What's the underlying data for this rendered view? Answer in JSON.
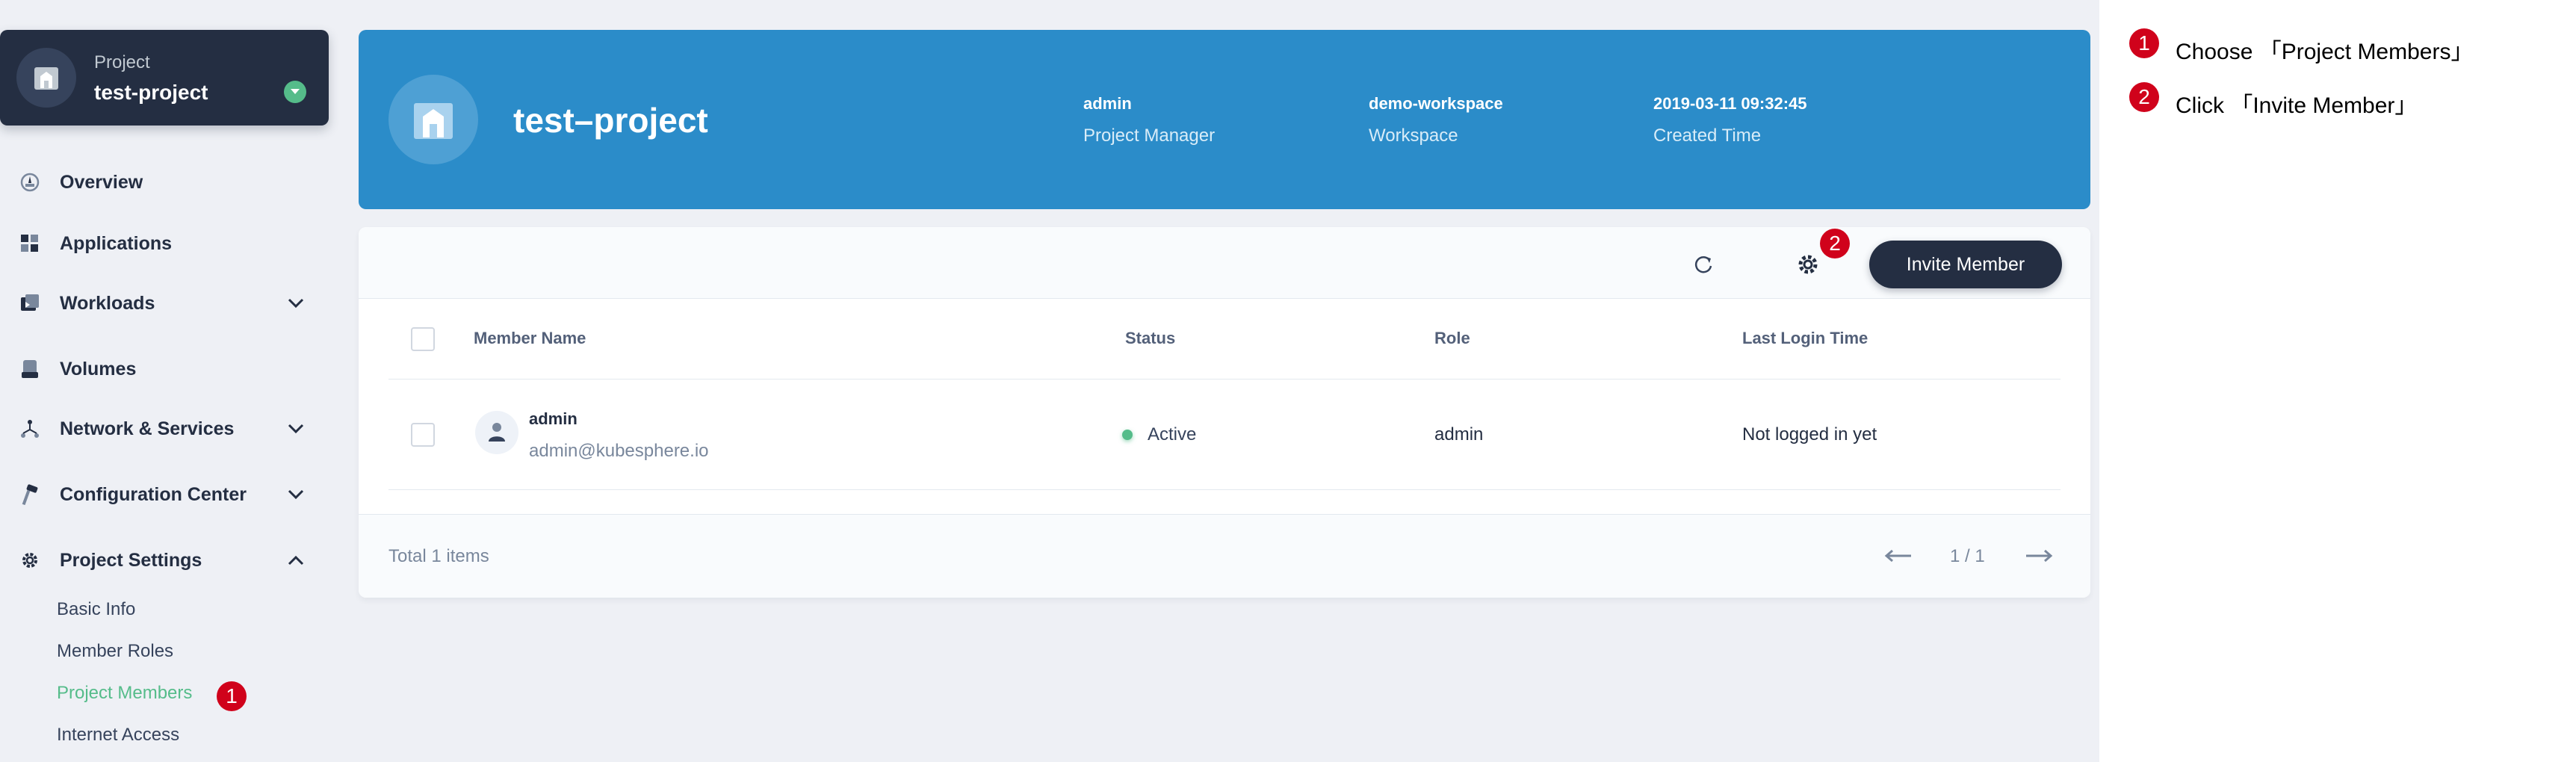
{
  "sidebar": {
    "project": {
      "label": "Project",
      "name": "test-project"
    },
    "items": [
      {
        "label": "Overview"
      },
      {
        "label": "Applications"
      },
      {
        "label": "Workloads"
      },
      {
        "label": "Volumes"
      },
      {
        "label": "Network & Services"
      },
      {
        "label": "Configuration Center"
      },
      {
        "label": "Project Settings"
      }
    ],
    "settings_sub": [
      {
        "label": "Basic Info"
      },
      {
        "label": "Member Roles"
      },
      {
        "label": "Project Members"
      },
      {
        "label": "Internet Access"
      }
    ]
  },
  "banner": {
    "title": "test–project",
    "meta": [
      {
        "value": "admin",
        "label": "Project Manager"
      },
      {
        "value": "demo-workspace",
        "label": "Workspace"
      },
      {
        "value": "2019-03-11 09:32:45",
        "label": "Created Time"
      }
    ]
  },
  "toolbar": {
    "invite_label": "Invite Member"
  },
  "table": {
    "columns": [
      "Member Name",
      "Status",
      "Role",
      "Last Login Time"
    ],
    "rows": [
      {
        "name": "admin",
        "email": "admin@kubesphere.io",
        "status": "Active",
        "role": "admin",
        "last_login": "Not logged in yet"
      }
    ]
  },
  "footer": {
    "total": "Total 1 items",
    "page": "1 / 1"
  },
  "markers": {
    "one": "1",
    "two": "2"
  },
  "steps": [
    {
      "num": "1",
      "text": "Choose 「Project Members」"
    },
    {
      "num": "2",
      "text": "Click 「Invite Member」"
    }
  ],
  "colors": {
    "accent_green": "#55bc8a",
    "banner_blue": "#2b8cc9",
    "dark": "#242e42",
    "marker_red": "#d0021b"
  }
}
